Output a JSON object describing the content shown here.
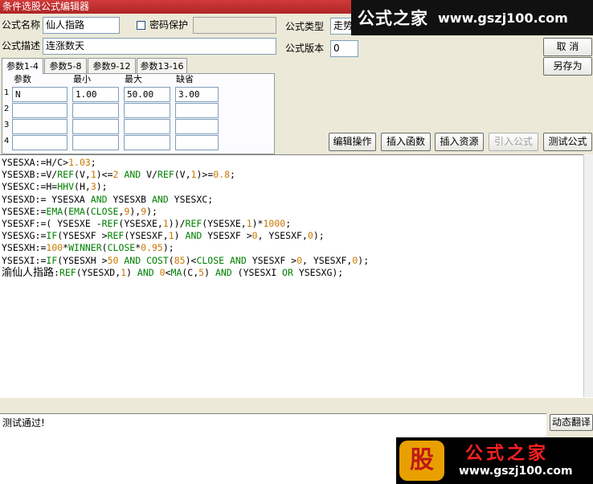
{
  "window": {
    "title": "条件选股公式编辑器"
  },
  "form": {
    "name_label": "公式名称",
    "name_value": "仙人指路",
    "password_label": "密码保护",
    "password_value": "",
    "type_label": "公式类型",
    "type_value": "走势",
    "desc_label": "公式描述",
    "desc_value": "连涨数天",
    "version_label": "公式版本",
    "version_value": "0"
  },
  "buttons": {
    "cancel": "取  消",
    "save_as": "另存为",
    "edit_ops": "编辑操作",
    "insert_func": "插入函数",
    "insert_resource": "插入资源",
    "import_formula": "引入公式",
    "test_formula": "测试公式",
    "dynamic_translate": "动态翻译"
  },
  "tabs": [
    "参数1-4",
    "参数5-8",
    "参数9-12",
    "参数13-16"
  ],
  "params": {
    "headers": [
      "参数",
      "最小",
      "最大",
      "缺省"
    ],
    "row_numbers": [
      "1",
      "2",
      "3",
      "4"
    ],
    "rows": [
      [
        "N",
        "1.00",
        "50.00",
        "3.00"
      ],
      [
        "",
        "",
        "",
        ""
      ],
      [
        "",
        "",
        "",
        ""
      ],
      [
        "",
        "",
        "",
        ""
      ]
    ]
  },
  "code": [
    [
      [
        "t",
        "YSESXA:=H/C>"
      ],
      [
        "n",
        "1.03"
      ],
      [
        "t",
        ";"
      ]
    ],
    [
      [
        "t",
        "YSESXB:=V/"
      ],
      [
        "k",
        "REF"
      ],
      [
        "t",
        "(V,"
      ],
      [
        "n",
        "1"
      ],
      [
        "t",
        ")<="
      ],
      [
        "n",
        "2"
      ],
      [
        "t",
        " "
      ],
      [
        "k",
        "AND"
      ],
      [
        "t",
        " V/"
      ],
      [
        "k",
        "REF"
      ],
      [
        "t",
        "(V,"
      ],
      [
        "n",
        "1"
      ],
      [
        "t",
        ")>="
      ],
      [
        "n",
        "0.8"
      ],
      [
        "t",
        ";"
      ]
    ],
    [
      [
        "t",
        "YSESXC:=H="
      ],
      [
        "k",
        "HHV"
      ],
      [
        "t",
        "(H,"
      ],
      [
        "n",
        "3"
      ],
      [
        "t",
        ");"
      ]
    ],
    [
      [
        "t",
        "YSESXD:= YSESXA "
      ],
      [
        "k",
        "AND"
      ],
      [
        "t",
        " YSESXB "
      ],
      [
        "k",
        "AND"
      ],
      [
        "t",
        " YSESXC;"
      ]
    ],
    [
      [
        "t",
        "YSESXE:="
      ],
      [
        "k",
        "EMA"
      ],
      [
        "t",
        "("
      ],
      [
        "k",
        "EMA"
      ],
      [
        "t",
        "("
      ],
      [
        "k",
        "CLOSE"
      ],
      [
        "t",
        ","
      ],
      [
        "n",
        "9"
      ],
      [
        "t",
        "),"
      ],
      [
        "n",
        "9"
      ],
      [
        "t",
        ");"
      ]
    ],
    [
      [
        "t",
        "YSESXF:=( YSESXE -"
      ],
      [
        "k",
        "REF"
      ],
      [
        "t",
        "(YSESXE,"
      ],
      [
        "n",
        "1"
      ],
      [
        "t",
        "))/"
      ],
      [
        "k",
        "REF"
      ],
      [
        "t",
        "(YSESXE,"
      ],
      [
        "n",
        "1"
      ],
      [
        "t",
        ")*"
      ],
      [
        "n",
        "1000"
      ],
      [
        "t",
        ";"
      ]
    ],
    [
      [
        "t",
        "YSESXG:="
      ],
      [
        "k",
        "IF"
      ],
      [
        "t",
        "(YSESXF >"
      ],
      [
        "k",
        "REF"
      ],
      [
        "t",
        "(YSESXF,"
      ],
      [
        "n",
        "1"
      ],
      [
        "t",
        ") "
      ],
      [
        "k",
        "AND"
      ],
      [
        "t",
        " YSESXF >"
      ],
      [
        "n",
        "0"
      ],
      [
        "t",
        ", YSESXF,"
      ],
      [
        "n",
        "0"
      ],
      [
        "t",
        ");"
      ]
    ],
    [
      [
        "t",
        "YSESXH:="
      ],
      [
        "n",
        "100"
      ],
      [
        "t",
        "*"
      ],
      [
        "k",
        "WINNER"
      ],
      [
        "t",
        "("
      ],
      [
        "k",
        "CLOSE"
      ],
      [
        "t",
        "*"
      ],
      [
        "n",
        "0.95"
      ],
      [
        "t",
        ");"
      ]
    ],
    [
      [
        "t",
        "YSESXI:="
      ],
      [
        "k",
        "IF"
      ],
      [
        "t",
        "(YSESXH >"
      ],
      [
        "n",
        "50"
      ],
      [
        "t",
        " "
      ],
      [
        "k",
        "AND"
      ],
      [
        "t",
        " "
      ],
      [
        "k",
        "COST"
      ],
      [
        "t",
        "("
      ],
      [
        "n",
        "85"
      ],
      [
        "t",
        ")<"
      ],
      [
        "k",
        "CLOSE"
      ],
      [
        "t",
        " "
      ],
      [
        "k",
        "AND"
      ],
      [
        "t",
        " YSESXF >"
      ],
      [
        "n",
        "0"
      ],
      [
        "t",
        ", YSESXF,"
      ],
      [
        "n",
        "0"
      ],
      [
        "t",
        ");"
      ]
    ],
    [
      [
        "c",
        "渝仙人指路"
      ],
      [
        "t",
        ":"
      ],
      [
        "k",
        "REF"
      ],
      [
        "t",
        "(YSESXD,"
      ],
      [
        "n",
        "1"
      ],
      [
        "t",
        ") "
      ],
      [
        "k",
        "AND"
      ],
      [
        "t",
        " "
      ],
      [
        "n",
        "0"
      ],
      [
        "t",
        "<"
      ],
      [
        "k",
        "MA"
      ],
      [
        "t",
        "(C,"
      ],
      [
        "n",
        "5"
      ],
      [
        "t",
        ") "
      ],
      [
        "k",
        "AND"
      ],
      [
        "t",
        " (YSESXI "
      ],
      [
        "k",
        "OR"
      ],
      [
        "t",
        " YSESXG);"
      ]
    ]
  ],
  "status": {
    "message": "测试通过!"
  },
  "watermarks": {
    "top_brand": "公式之家",
    "top_url": "www.gszj100.com",
    "bottom_logo": "股",
    "bottom_brand": "公式之家",
    "bottom_url": "www.gszj100.com"
  }
}
